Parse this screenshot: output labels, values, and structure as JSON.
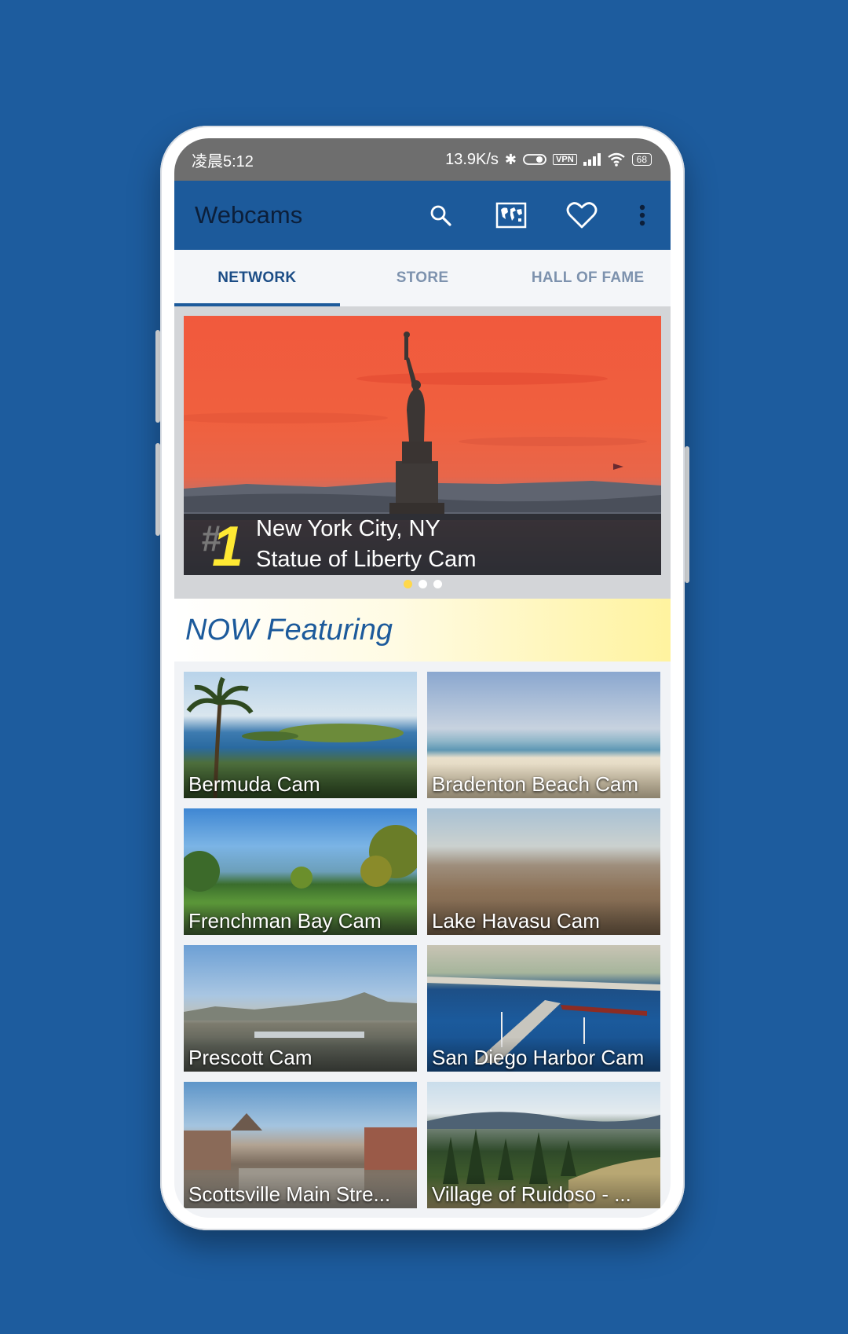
{
  "status_bar": {
    "time": "凌晨5:12",
    "network_speed": "13.9K/s",
    "bluetooth_icon": "✱",
    "vpn_label": "VPN",
    "battery": "68"
  },
  "toolbar": {
    "title": "Webcams",
    "icons": [
      "search-icon",
      "world-map-icon",
      "heart-icon",
      "more-vert-icon"
    ]
  },
  "tabs": [
    {
      "label": "NETWORK",
      "active": true
    },
    {
      "label": "STORE",
      "active": false
    },
    {
      "label": "HALL OF FAME",
      "active": false
    }
  ],
  "hero": {
    "rank_hash": "#",
    "rank_number": "1",
    "location": "New York City, NY",
    "cam_name": "Statue of Liberty Cam",
    "pages": 3,
    "active_page": 1
  },
  "featuring": {
    "title": "NOW Featuring"
  },
  "cams": [
    {
      "label": "Bermuda Cam"
    },
    {
      "label": "Bradenton Beach Cam"
    },
    {
      "label": "Frenchman Bay Cam"
    },
    {
      "label": "Lake Havasu Cam"
    },
    {
      "label": "Prescott Cam"
    },
    {
      "label": "San Diego Harbor Cam"
    },
    {
      "label": "Scottsville Main Stre..."
    },
    {
      "label": "Village of Ruidoso - ..."
    }
  ],
  "colors": {
    "background": "#1d5c9e",
    "toolbar": "#1c5a9b",
    "rank_accent": "#ffe933",
    "featuring_accent": "#fff39f"
  }
}
